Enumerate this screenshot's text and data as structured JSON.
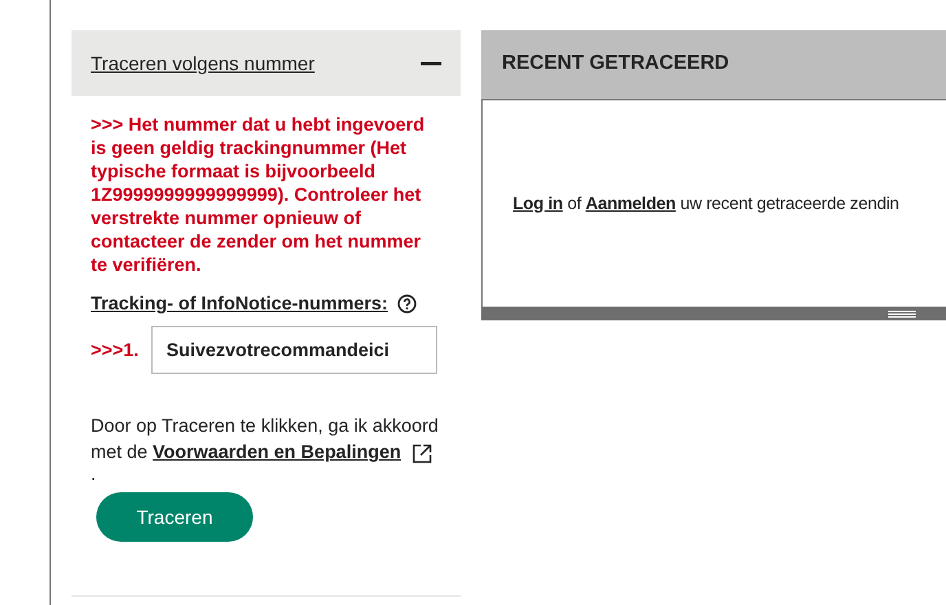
{
  "track_panel": {
    "title": "Traceren volgens nummer",
    "expanded": true,
    "error": ">>> Het nummer dat u hebt ingevoerd is geen geldig trackingnummer (Het typische formaat is bijvoorbeeld 1Z9999999999999999). Controleer het verstrekte nummer opnieuw of contacteer de zender om het nummer te verifiëren.",
    "field_label": "Tracking- of InfoNotice-nummers:",
    "rows": [
      {
        "marker": ">>>1.",
        "value": "Suivezvotrecommandeici"
      }
    ],
    "terms": {
      "text_before": "Door op Traceren te klikken, ga ik akkoord met de",
      "link": "Voorwaarden en Bepalingen",
      "after": "."
    },
    "button": "Traceren"
  },
  "recent_panel": {
    "title": "RECENT GETRACEERD",
    "login_link": "Log in",
    "between": "of",
    "register_link": "Aanmelden",
    "after": "uw recent getraceerde zendin"
  }
}
